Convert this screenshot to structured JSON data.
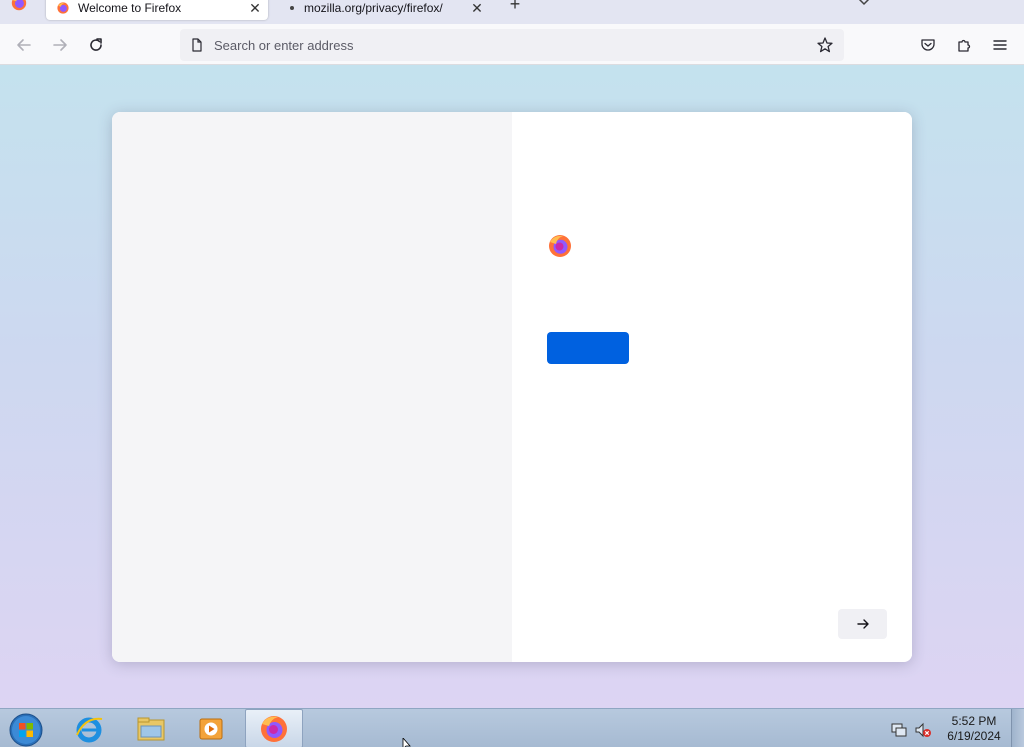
{
  "browser": {
    "tabs": [
      {
        "title": "Welcome to Firefox",
        "active": true
      },
      {
        "title": "mozilla.org/privacy/firefox/",
        "active": false
      }
    ],
    "newtab_label": "+",
    "urlbar": {
      "placeholder": "Search or enter address",
      "value": ""
    }
  },
  "welcome": {
    "logo_icon": "firefox-logo-icon",
    "primary_button_label": "",
    "next_icon": "arrow-right-icon"
  },
  "taskbar": {
    "apps": [
      "start-orb",
      "internet-explorer-icon",
      "file-explorer-icon",
      "media-player-icon",
      "firefox-icon"
    ],
    "tray": [
      "network-icon",
      "volume-muted-icon"
    ],
    "clock": {
      "time": "5:52 PM",
      "date": "6/19/2024"
    }
  },
  "colors": {
    "accent": "#0061e0",
    "urlbar_bg": "#f0f0f4",
    "tabstrip_bg": "#e3e5f2"
  }
}
